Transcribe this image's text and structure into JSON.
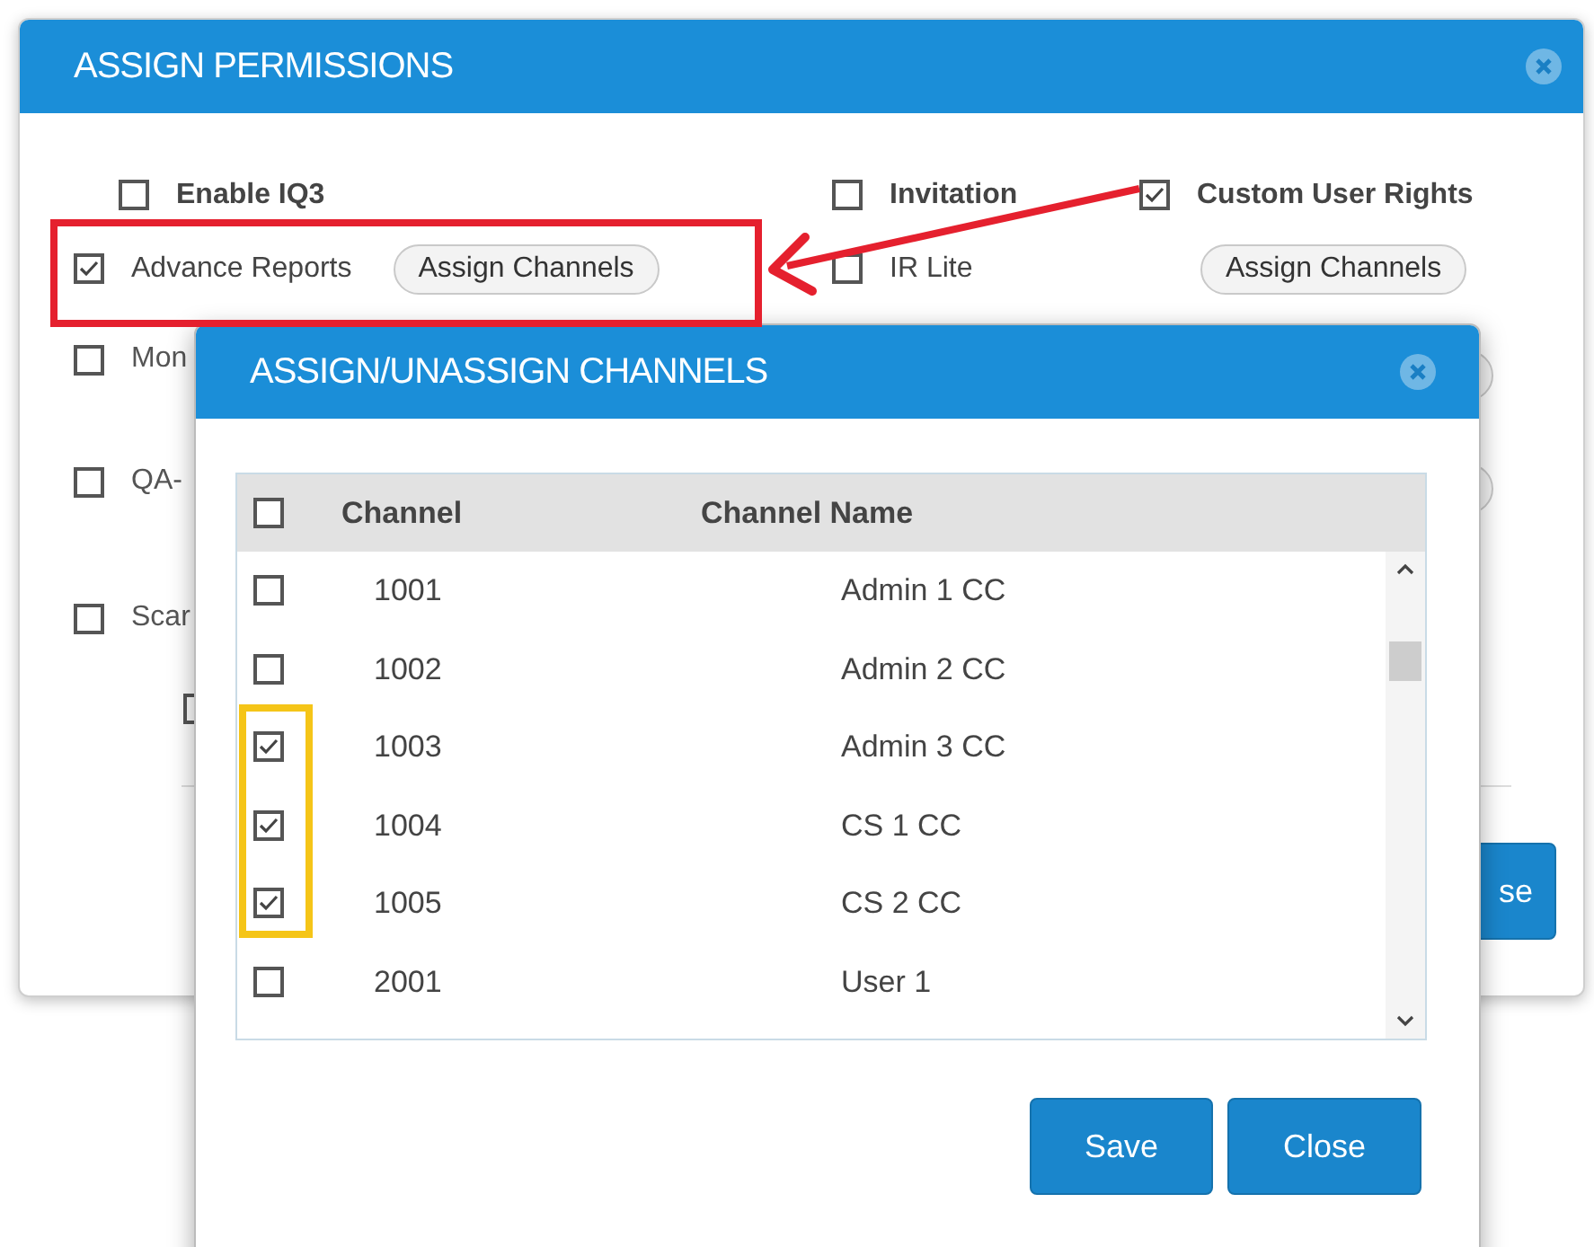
{
  "permissions_dialog": {
    "title": "ASSIGN PERMISSIONS",
    "top_rows": [
      [
        {
          "kind": "checkbox",
          "label": "Enable IQ3",
          "checked": false,
          "bold": true
        },
        {
          "kind": "checkbox",
          "label": "Invitation",
          "checked": false,
          "bold": true
        },
        {
          "kind": "checkbox",
          "label": "Custom User Rights",
          "checked": true,
          "bold": true
        }
      ],
      [
        {
          "kind": "checkbox",
          "label": "Advance Reports",
          "checked": true,
          "bold": false,
          "button": "Assign Channels"
        },
        {
          "kind": "checkbox",
          "label": "IR Lite",
          "checked": false,
          "bold": false
        },
        {
          "kind": "button",
          "button": "Assign Channels"
        }
      ]
    ],
    "left_options": [
      {
        "label": "Mon",
        "checked": false
      },
      {
        "label": "QA-",
        "checked": false
      },
      {
        "label": "Scar",
        "checked": false,
        "sub_option": {
          "kind": "checkbox"
        }
      }
    ],
    "footer_button": "se"
  },
  "channels_dialog": {
    "title": "ASSIGN/UNASSIGN CHANNELS",
    "select_all": {
      "checked": false
    },
    "columns": [
      "Channel",
      "Channel Name"
    ],
    "rows": [
      {
        "channel": "1001",
        "name": "Admin 1 CC",
        "checked": false
      },
      {
        "channel": "1002",
        "name": "Admin 2 CC",
        "checked": false
      },
      {
        "channel": "1003",
        "name": "Admin 3 CC",
        "checked": true
      },
      {
        "channel": "1004",
        "name": "CS 1 CC",
        "checked": true
      },
      {
        "channel": "1005",
        "name": "CS 2 CC",
        "checked": true
      },
      {
        "channel": "2001",
        "name": "User 1",
        "checked": false
      }
    ],
    "buttons": [
      "Save",
      "Close"
    ]
  }
}
